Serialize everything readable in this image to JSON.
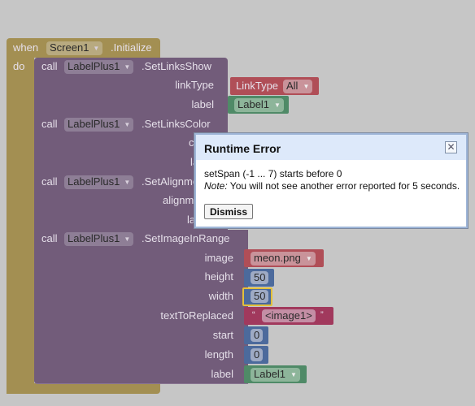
{
  "event": {
    "when": "when",
    "component": "Screen1",
    "event_name": ".Initialize",
    "do": "do"
  },
  "blocks": [
    {
      "call": "call",
      "component": "LabelPlus1",
      "method": ".SetLinksShow",
      "params": [
        {
          "name": "linkType",
          "value_prefix": "LinkType",
          "value": "All"
        },
        {
          "name": "label",
          "value": "Label1"
        }
      ]
    },
    {
      "call": "call",
      "component": "LabelPlus1",
      "method": ".SetLinksColor",
      "params": [
        {
          "name": "color"
        },
        {
          "name": "label"
        }
      ]
    },
    {
      "call": "call",
      "component": "LabelPlus1",
      "method": ".SetAlignment",
      "params": [
        {
          "name": "alignment"
        },
        {
          "name": "label"
        }
      ]
    },
    {
      "call": "call",
      "component": "LabelPlus1",
      "method": ".SetImageInRange",
      "params": [
        {
          "name": "image",
          "value": "meon.png"
        },
        {
          "name": "height",
          "value": "50"
        },
        {
          "name": "width",
          "value": "50"
        },
        {
          "name": "textToReplaced",
          "value": "<image1>",
          "open_quote": "“",
          "close_quote": "”"
        },
        {
          "name": "start",
          "value": "0"
        },
        {
          "name": "length",
          "value": "0"
        },
        {
          "name": "label",
          "value": "Label1"
        }
      ]
    }
  ],
  "dialog": {
    "title": "Runtime Error",
    "message": "setSpan (-1 ... 7) starts before 0",
    "note_label": "Note:",
    "note_text": " You will not see another error reported for 5 seconds.",
    "dismiss": "Dismiss",
    "close_icon": "close-icon"
  },
  "colors": {
    "event": "#a38f52",
    "procedure": "#725c7a",
    "text": "#a1395d",
    "math": "#4c6a9c",
    "component": "#4f8a67",
    "helper": "#b04e57",
    "selected_outline": "#e3c03a"
  }
}
